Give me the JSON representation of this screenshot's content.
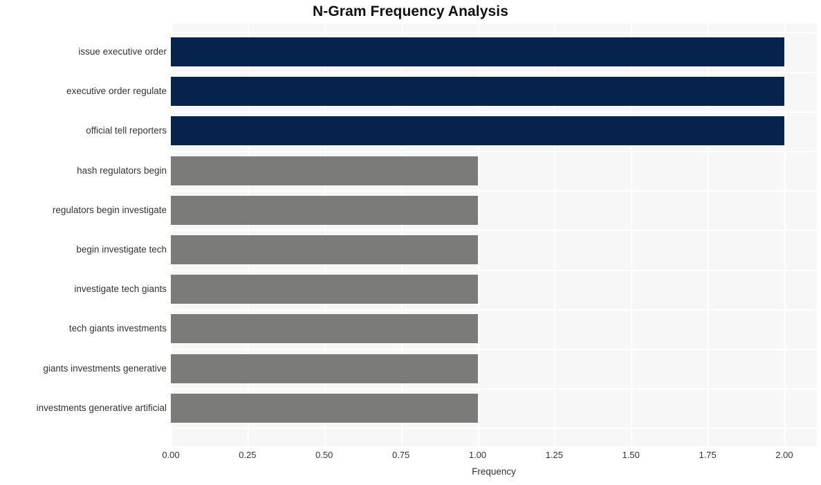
{
  "chart_data": {
    "type": "bar",
    "orientation": "horizontal",
    "title": "N-Gram Frequency Analysis",
    "xlabel": "Frequency",
    "ylabel": "",
    "xlim": [
      0,
      2
    ],
    "xticks": [
      "0.00",
      "0.25",
      "0.50",
      "0.75",
      "1.00",
      "1.25",
      "1.50",
      "1.75",
      "2.00"
    ],
    "xtick_values": [
      0,
      0.25,
      0.5,
      0.75,
      1,
      1.25,
      1.5,
      1.75,
      2
    ],
    "grid": true,
    "legend": null,
    "categories": [
      "issue executive order",
      "executive order regulate",
      "official tell reporters",
      "hash regulators begin",
      "regulators begin investigate",
      "begin investigate tech",
      "investigate tech giants",
      "tech giants investments",
      "giants investments generative",
      "investments generative artificial"
    ],
    "values": [
      2,
      2,
      2,
      1,
      1,
      1,
      1,
      1,
      1,
      1
    ],
    "bar_colors": [
      "#05234c",
      "#05234c",
      "#05234c",
      "#7b7b79",
      "#7b7b79",
      "#7b7b79",
      "#7b7b79",
      "#7b7b79",
      "#7b7b79",
      "#7b7b79"
    ],
    "colors": {
      "highlight": "#05234c",
      "normal": "#7b7b79",
      "plot_background": "#f7f7f7",
      "grid": "#ffffff",
      "figure_background": "#ffffff",
      "text": "#333333",
      "title": "#111111"
    }
  }
}
